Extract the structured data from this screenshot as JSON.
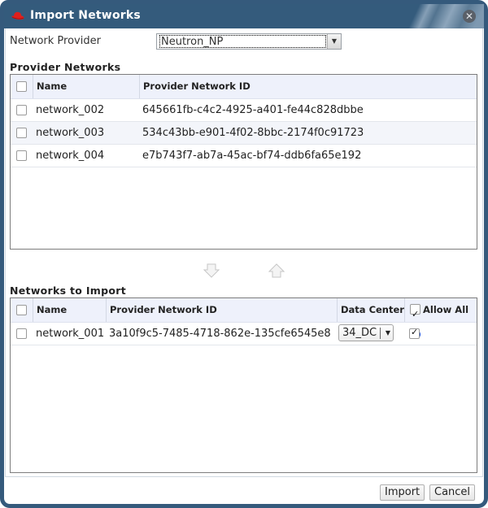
{
  "dialog": {
    "title": "Import Networks",
    "close_icon": "close-icon",
    "logo_icon": "redhat-logo-icon"
  },
  "provider": {
    "label": "Network Provider",
    "selected": "Neutron_NP"
  },
  "provider_networks": {
    "title": "Provider Networks",
    "columns": [
      "Name",
      "Provider Network ID"
    ],
    "rows": [
      {
        "name": "network_002",
        "id": "645661fb-c4c2-4925-a401-fe44c828dbbe",
        "checked": false
      },
      {
        "name": "network_003",
        "id": "534c43bb-e901-4f02-8bbc-2174f0c91723",
        "checked": false
      },
      {
        "name": "network_004",
        "id": "e7b743f7-ab7a-45ac-bf74-ddb6fa65e192",
        "checked": false
      }
    ]
  },
  "move": {
    "down_icon": "arrow-down-icon",
    "up_icon": "arrow-up-icon"
  },
  "networks_to_import": {
    "title": "Networks to Import",
    "columns": [
      "Name",
      "Provider Network ID",
      "Data Center",
      "Allow All"
    ],
    "allow_all_checked": true,
    "help_glyph": "?",
    "rows": [
      {
        "name": "network_001",
        "id": "3a10f9c5-7485-4718-862e-135cfe6545e8",
        "data_center": "34_DC",
        "allow_all": true,
        "checked": false
      }
    ]
  },
  "buttons": {
    "import": "Import",
    "cancel": "Cancel"
  }
}
